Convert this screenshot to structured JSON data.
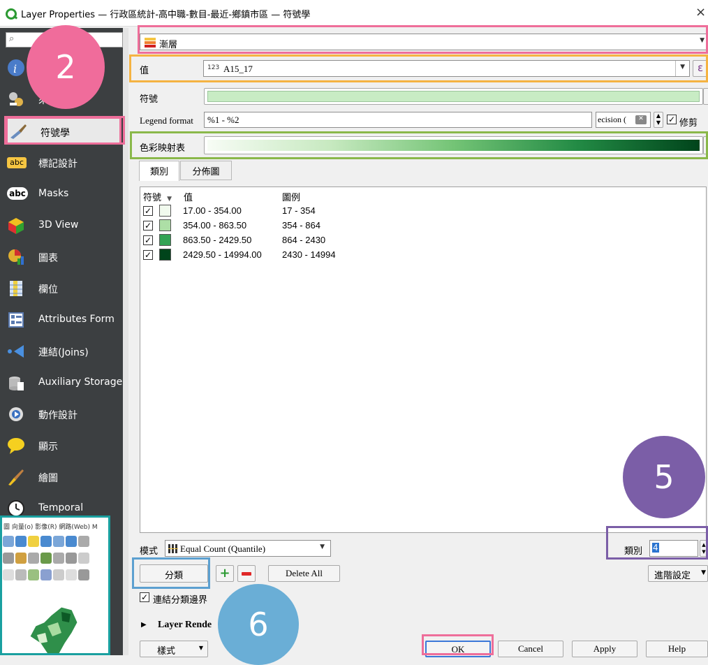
{
  "window": {
    "title": "Layer Properties — 行政區統計-高中職-數目-最近-鄉鎮市區 — 符號學",
    "close_symbol": "×"
  },
  "sidebar": {
    "search_placeholder": "",
    "items": [
      {
        "label": "",
        "icon": "info-icon"
      },
      {
        "label": "來",
        "icon": "source-icon"
      },
      {
        "label": "符號學",
        "icon": "symbology-brush-icon"
      },
      {
        "label": "標記設計",
        "icon": "labels-abc-icon"
      },
      {
        "label": "Masks",
        "icon": "masks-abc-icon"
      },
      {
        "label": "3D View",
        "icon": "cube-3d-icon"
      },
      {
        "label": "圖表",
        "icon": "diagram-icon"
      },
      {
        "label": "欄位",
        "icon": "fields-icon"
      },
      {
        "label": "Attributes Form",
        "icon": "attributes-form-icon"
      },
      {
        "label": "連結(Joins)",
        "icon": "joins-icon"
      },
      {
        "label": "Auxiliary Storage",
        "icon": "auxiliary-storage-icon"
      },
      {
        "label": "動作設計",
        "icon": "actions-gear-icon"
      },
      {
        "label": "顯示",
        "icon": "display-speech-icon"
      },
      {
        "label": "繪圖",
        "icon": "rendering-brush-icon"
      },
      {
        "label": "Temporal",
        "icon": "temporal-clock-icon"
      }
    ]
  },
  "renderer": {
    "type_label": "漸層"
  },
  "value": {
    "label": "值",
    "field": "A15_17",
    "field_type_badge": "123",
    "expr_symbol": "ε"
  },
  "symbol": {
    "label": "符號"
  },
  "legend_format": {
    "label": "Legend format",
    "value": "%1 - %2",
    "precision_text": "ecision (",
    "clip_label": "修剪",
    "clip_checked": true
  },
  "color_ramp": {
    "label": "色彩映射表"
  },
  "tabs": {
    "classes": "類別",
    "histogram": "分佈圖"
  },
  "table": {
    "headers": {
      "symbol": "符號",
      "value": "值",
      "legend": "圖例"
    },
    "rows": [
      {
        "value": "17.00 - 354.00",
        "legend": "17 - 354",
        "color": "#f1faee",
        "checked": true
      },
      {
        "value": "354.00 - 863.50",
        "legend": "354 - 864",
        "color": "#addfa6",
        "checked": true
      },
      {
        "value": "863.50 - 2429.50",
        "legend": "864 - 2430",
        "color": "#33a354",
        "checked": true
      },
      {
        "value": "2429.50 - 14994.00",
        "legend": "2430 - 14994",
        "color": "#00441b",
        "checked": true
      }
    ]
  },
  "mode": {
    "label": "模式",
    "value": "Equal Count (Quantile)"
  },
  "classes_count": {
    "label": "類別",
    "value": "4"
  },
  "buttons": {
    "classify": "分類",
    "add_symbol": "+",
    "remove_symbol": "−",
    "delete_all": "Delete All",
    "advanced": "進階設定",
    "style": "樣式",
    "ok": "OK",
    "cancel": "Cancel",
    "apply": "Apply",
    "help": "Help"
  },
  "link_class_boundaries": {
    "label": "連結分類邊界",
    "checked": true
  },
  "layer_rendering": {
    "label": "Layer Rende"
  },
  "annotations": [
    "2",
    "5",
    "6"
  ],
  "preview_menu": "圖 向量(o) 影像(R) 網路(Web) M",
  "colors": {
    "highlight_pink": "#ee6e9a",
    "highlight_orange": "#f5b342",
    "highlight_green": "#8ab84a",
    "highlight_purple": "#7b5ea7",
    "highlight_blue": "#5ca0d0",
    "highlight_teal": "#1aa0a0",
    "circle_pink": "#f06c9b",
    "circle_purple": "#7b5ea7",
    "circle_blue": "#6aaed6",
    "sidebar_bg": "#3c3f41"
  }
}
